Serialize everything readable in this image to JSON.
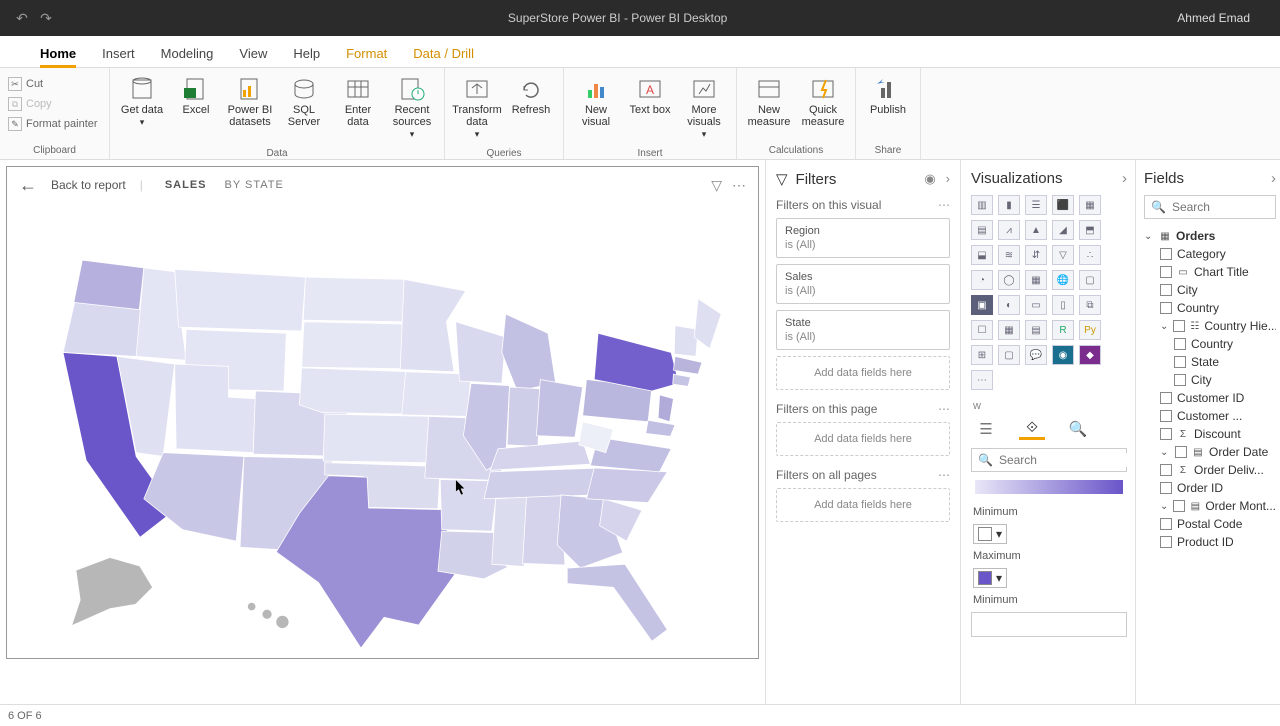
{
  "titlebar": {
    "title": "SuperStore Power BI - Power BI Desktop",
    "user": "Ahmed Emad"
  },
  "tabs": [
    "Home",
    "Insert",
    "Modeling",
    "View",
    "Help",
    "Format",
    "Data / Drill"
  ],
  "activeTab": "Home",
  "clipboard": {
    "cut": "Cut",
    "copy": "Copy",
    "painter": "Format painter",
    "group": "Clipboard"
  },
  "ribbon": {
    "data": {
      "get": "Get data",
      "excel": "Excel",
      "pbi": "Power BI datasets",
      "sql": "SQL Server",
      "enter": "Enter data",
      "recent": "Recent sources",
      "group": "Data"
    },
    "queries": {
      "transform": "Transform data",
      "refresh": "Refresh",
      "group": "Queries"
    },
    "insert": {
      "newv": "New visual",
      "text": "Text box",
      "more": "More visuals",
      "group": "Insert"
    },
    "calc": {
      "newm": "New measure",
      "quick": "Quick measure",
      "group": "Calculations"
    },
    "share": {
      "pub": "Publish",
      "group": "Share"
    }
  },
  "canvas": {
    "back": "Back to report",
    "chip1": "SALES",
    "chip2": "BY STATE"
  },
  "filters": {
    "title": "Filters",
    "sect_visual": "Filters on this visual",
    "cards": [
      {
        "name": "Region",
        "value": "is (All)"
      },
      {
        "name": "Sales",
        "value": "is (All)"
      },
      {
        "name": "State",
        "value": "is (All)"
      }
    ],
    "drop": "Add data fields here",
    "sect_page": "Filters on this page",
    "sect_all": "Filters on all pages"
  },
  "viz": {
    "title": "Visualizations",
    "searchph": "Search",
    "min": "Minimum",
    "max": "Maximum",
    "letter": "w"
  },
  "fields": {
    "title": "Fields",
    "searchph": "Search",
    "table": "Orders",
    "items": [
      "Category",
      "Chart Title",
      "City",
      "Country",
      "Country Hie...",
      "Country",
      "State",
      "City",
      "Customer ID",
      "Customer ...",
      "Discount",
      "Order Date",
      "Order Deliv...",
      "Order ID",
      "Order Mont...",
      "Postal Code",
      "Product ID"
    ]
  },
  "status": "6 OF 6",
  "chart_data": {
    "type": "map",
    "region": "USA states choropleth",
    "measure": "Sales",
    "color_scale": {
      "low": "#e5e8f7",
      "high": "#6a55c9"
    },
    "note": "California and New York rendered darkest (highest); Texas medium-high; Alaska no-data (grey); most central states light.",
    "series": [
      {
        "state": "California",
        "bucket": "high"
      },
      {
        "state": "New York",
        "bucket": "high"
      },
      {
        "state": "Texas",
        "bucket": "med-high"
      },
      {
        "state": "Washington",
        "bucket": "med"
      },
      {
        "state": "Pennsylvania",
        "bucket": "med"
      },
      {
        "state": "Florida",
        "bucket": "med"
      },
      {
        "state": "Ohio",
        "bucket": "med"
      },
      {
        "state": "Illinois",
        "bucket": "med"
      },
      {
        "state": "Michigan",
        "bucket": "med"
      },
      {
        "state": "Virginia",
        "bucket": "med"
      },
      {
        "state": "Alaska",
        "bucket": "nodata"
      }
    ]
  }
}
